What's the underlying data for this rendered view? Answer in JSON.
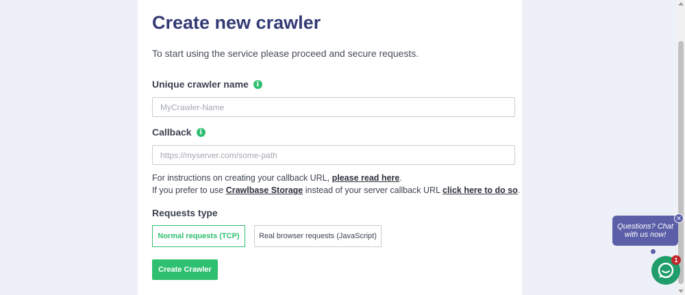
{
  "page": {
    "title": "Create new crawler",
    "subtitle": "To start using the service please proceed and secure requests."
  },
  "crawler_name": {
    "label": "Unique crawler name",
    "placeholder": "MyCrawler-Name",
    "value": ""
  },
  "callback": {
    "label": "Callback",
    "placeholder": "https://myserver.com/some-path",
    "value": ""
  },
  "help": {
    "line1_prefix": "For instructions on creating your callback URL, ",
    "line1_link": "please read here",
    "line1_suffix": ".",
    "line2_prefix": "If you prefer to use ",
    "line2_link1": "Crawlbase Storage",
    "line2_mid": " instead of your server callback URL ",
    "line2_link2": "click here to do so",
    "line2_suffix": "."
  },
  "requests_type": {
    "label": "Requests type",
    "options": [
      {
        "label": "Normal requests (TCP)",
        "selected": true
      },
      {
        "label": "Real browser requests (JavaScript)",
        "selected": false
      }
    ]
  },
  "create_button": "Create Crawler",
  "chat": {
    "bubble_line1": "Questions? Chat",
    "bubble_line2": "with us now!",
    "close": "✕",
    "badge": "1"
  },
  "colors": {
    "accent_green": "#2fbf71",
    "title_navy": "#333a74",
    "chat_purple": "#5a5fa8",
    "background": "#eef0f8"
  },
  "icons": [
    "info-icon",
    "close-icon",
    "chat-icon"
  ]
}
